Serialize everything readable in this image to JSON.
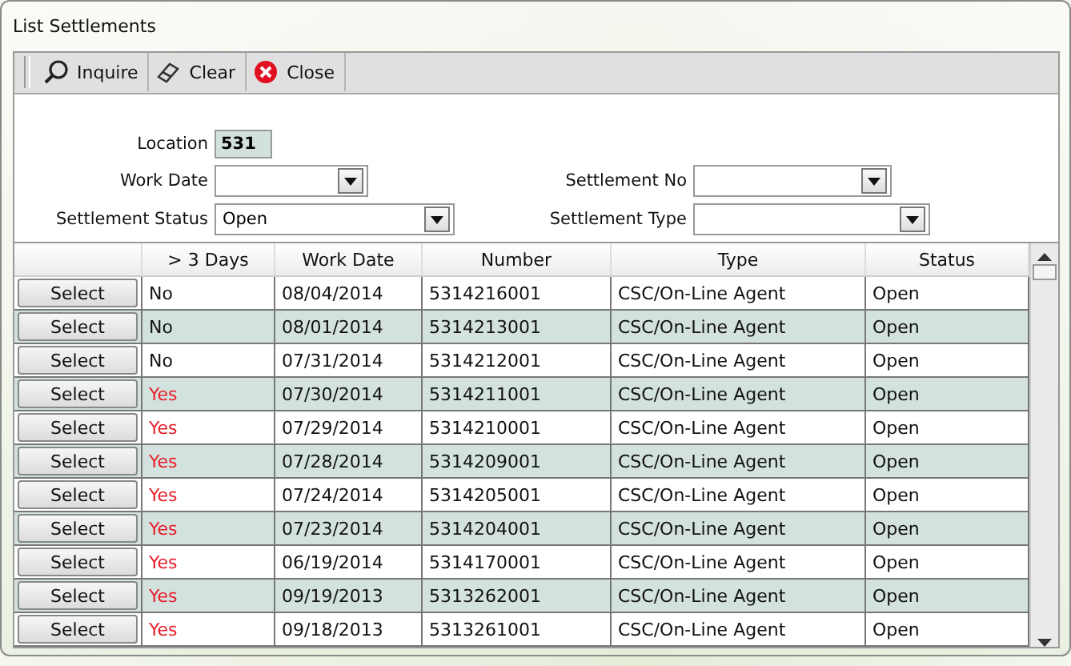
{
  "window": {
    "title": "List Settlements"
  },
  "toolbar": [
    {
      "kind": "search",
      "label": "Inquire"
    },
    {
      "kind": "eraser",
      "label": "Clear"
    },
    {
      "kind": "close",
      "label": "Close"
    }
  ],
  "form": {
    "location": {
      "label": "Location",
      "value": "531"
    },
    "work_date": {
      "label": "Work Date"
    },
    "settlement_no": {
      "label": "Settlement No"
    },
    "settlement_status": {
      "label": "Settlement Status",
      "value": "Open"
    },
    "settlement_type": {
      "label": "Settlement Type"
    }
  },
  "table": {
    "columns": [
      "> 3 Days",
      "Work Date",
      "Number",
      "Type",
      "Status"
    ],
    "rows": [
      {
        "button": "Select",
        "days": "No",
        "late": false,
        "work_date": "08/04/2014",
        "number": "5314216001",
        "type": "CSC/On-Line Agent",
        "status": "Open"
      },
      {
        "button": "Select",
        "days": "No",
        "late": false,
        "work_date": "08/01/2014",
        "number": "5314213001",
        "type": "CSC/On-Line Agent",
        "status": "Open"
      },
      {
        "button": "Select",
        "days": "No",
        "late": false,
        "work_date": "07/31/2014",
        "number": "5314212001",
        "type": "CSC/On-Line Agent",
        "status": "Open"
      },
      {
        "button": "Select",
        "days": "Yes",
        "late": true,
        "work_date": "07/30/2014",
        "number": "5314211001",
        "type": "CSC/On-Line Agent",
        "status": "Open"
      },
      {
        "button": "Select",
        "days": "Yes",
        "late": true,
        "work_date": "07/29/2014",
        "number": "5314210001",
        "type": "CSC/On-Line Agent",
        "status": "Open"
      },
      {
        "button": "Select",
        "days": "Yes",
        "late": true,
        "work_date": "07/28/2014",
        "number": "5314209001",
        "type": "CSC/On-Line Agent",
        "status": "Open"
      },
      {
        "button": "Select",
        "days": "Yes",
        "late": true,
        "work_date": "07/24/2014",
        "number": "5314205001",
        "type": "CSC/On-Line Agent",
        "status": "Open"
      },
      {
        "button": "Select",
        "days": "Yes",
        "late": true,
        "work_date": "07/23/2014",
        "number": "5314204001",
        "type": "CSC/On-Line Agent",
        "status": "Open"
      },
      {
        "button": "Select",
        "days": "Yes",
        "late": true,
        "work_date": "06/19/2014",
        "number": "5314170001",
        "type": "CSC/On-Line Agent",
        "status": "Open"
      },
      {
        "button": "Select",
        "days": "Yes",
        "late": true,
        "work_date": "09/19/2013",
        "number": "5313262001",
        "type": "CSC/On-Line Agent",
        "status": "Open"
      },
      {
        "button": "Select",
        "days": "Yes",
        "late": true,
        "work_date": "09/18/2013",
        "number": "5313261001",
        "type": "CSC/On-Line Agent",
        "status": "Open"
      }
    ]
  }
}
